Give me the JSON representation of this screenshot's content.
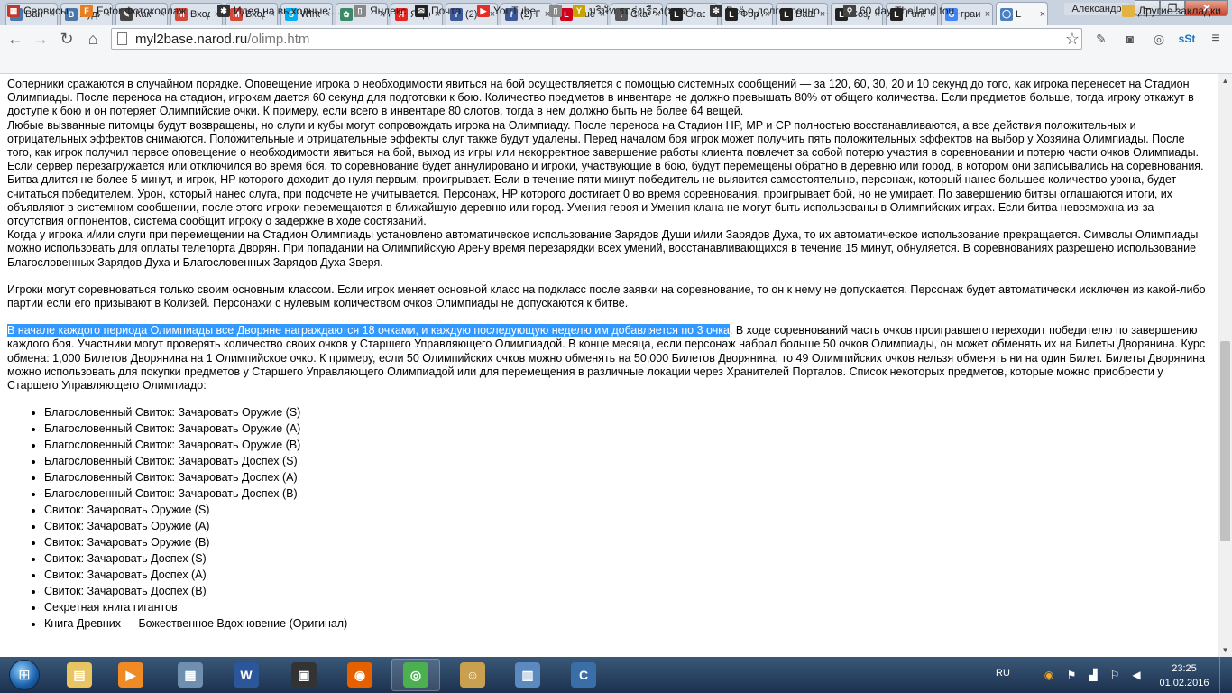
{
  "tabs": [
    {
      "label": "Ван",
      "icon": "vk-icon",
      "color": "#4a76a8",
      "glyph": "В"
    },
    {
      "label": "Ауди",
      "icon": "vk-icon",
      "color": "#4a76a8",
      "glyph": "В"
    },
    {
      "label": "Как",
      "icon": "pin-icon",
      "color": "#444444",
      "glyph": "✎"
    },
    {
      "label": "Вход",
      "icon": "gmail-icon",
      "color": "#d44638",
      "glyph": "M"
    },
    {
      "label": "Вход",
      "icon": "gmail-icon",
      "color": "#d44638",
      "glyph": "M"
    },
    {
      "label": "Winc",
      "icon": "skype-icon",
      "color": "#00aff0",
      "glyph": "S"
    },
    {
      "label": "Ol",
      "icon": "gear-icon",
      "color": "#3a8a6a",
      "glyph": "✿"
    },
    {
      "label": "Янде",
      "icon": "yandex-icon",
      "color": "#e52620",
      "glyph": "Я"
    },
    {
      "label": "(2) F",
      "icon": "facebook-icon",
      "color": "#3b5998",
      "glyph": "f"
    },
    {
      "label": "(2) F",
      "icon": "facebook-icon",
      "color": "#3b5998",
      "glyph": "f"
    },
    {
      "label": "Blue",
      "icon": "blue-icon",
      "color": "#d0021b",
      "glyph": "L"
    },
    {
      "label": "Скач",
      "icon": "download-icon",
      "color": "#555555",
      "glyph": "↓"
    },
    {
      "label": "Grac",
      "icon": "lineage-icon",
      "color": "#222222",
      "glyph": "L"
    },
    {
      "label": "Фор",
      "icon": "lineage-icon",
      "color": "#222222",
      "glyph": "L"
    },
    {
      "label": "Ваш",
      "icon": "lineage-icon",
      "color": "#222222",
      "glyph": "L"
    },
    {
      "label": "Созд",
      "icon": "lineage-icon",
      "color": "#222222",
      "glyph": "L"
    },
    {
      "label": "Fun6",
      "icon": "lineage-icon",
      "color": "#222222",
      "glyph": "L"
    },
    {
      "label": "граи",
      "icon": "google-icon",
      "color": "#4285f4",
      "glyph": "G"
    },
    {
      "label": "L",
      "icon": "olimp-icon",
      "color": "#4a7fc0",
      "glyph": "◯",
      "active": true
    }
  ],
  "user_name": "Александр",
  "address": {
    "host": "myl2base.narod.ru",
    "path": "/olimp.htm"
  },
  "bookmarks": [
    {
      "label": "Сервисы",
      "icon": "apps-grid-icon",
      "color": "#c0392b",
      "glyph": "▦"
    },
    {
      "label": "Fotor Фотоколлаж ...",
      "icon": "fotor-icon",
      "color": "#e67e22",
      "glyph": "F"
    },
    {
      "label": "Идея на выходные:...",
      "icon": "idea-icon",
      "color": "#333333",
      "glyph": "✱"
    },
    {
      "label": "Яндекс",
      "icon": "page-icon",
      "color": "#888888",
      "glyph": "▯"
    },
    {
      "label": "Почта",
      "icon": "mail-icon",
      "color": "#222222",
      "glyph": "✉"
    },
    {
      "label": "YouTube",
      "icon": "youtube-icon",
      "color": "#e52d27",
      "glyph": "▶"
    },
    {
      "label": "",
      "icon": "page-icon",
      "color": "#888888",
      "glyph": "▯"
    },
    {
      "label": "บริษัท รถรุ่งเรือง(มุกดา...",
      "icon": "thai-company-icon",
      "color": "#c9a400",
      "glyph": "Y"
    },
    {
      "label": "Всё о долгосрочно...",
      "icon": "palm-icon",
      "color": "#333333",
      "glyph": "✼"
    },
    {
      "label": "60 day Thailand tou...",
      "icon": "bike-icon",
      "color": "#444444",
      "glyph": "⚲"
    }
  ],
  "other_bookmarks": "Другие закладки",
  "article": {
    "p1": "Соперники сражаются в случайном порядке. Оповещение игрока о необходимости явиться на бой осуществляется с помощью системных сообщений — за 120, 60, 30, 20 и 10 секунд до того, как игрока перенесет на Стадион Олимпиады. После переноса на стадион, игрокам дается 60 секунд для подготовки к бою. Количество предметов в инвентаре не должно превышать 80% от общего количества. Если предметов больше, тогда игроку откажут в доступе к бою и он потеряет Олимпийские очки. К примеру, если всего в инвентаре 80 слотов, тогда в нем должно быть не более 64 вещей.",
    "p2": "Любые вызванные питомцы будут возвращены, но слуги и кубы могут сопровождать игрока на Олимпиаду. После переноса на Стадион HP, MP и CP полностью восстанавливаются, а все действия положительных и отрицательных эффектов снимаются. Положительные и отрицательные эффекты слуг также будут удалены. Перед началом боя игрок может получить пять положительных эффектов на выбор у Хозяина Олимпиады. После того, как игрок получил первое оповещение о необходимости явиться на бой, выход из игры или некорректное завершение работы клиента повлечет за собой потерю участия в соревновании и потерю части очков Олимпиады. Если сервер перезагружается или отключился во время боя, то соревнование будет аннулировано и игроки, участвующие в бою, будут перемещены обратно в деревню или город, в котором они записывались на соревнования.",
    "p3": "Битва длится не более 5 минут, и игрок, HP которого доходит до нуля первым, проигрывает. Если в течение пяти минут победитель не выявится самостоятельно, персонаж, который нанес большее количество урона, будет считаться победителем. Урон, который нанес слуга, при подсчете не учитывается. Персонаж, HP которого достигает 0 во время соревнования, проигрывает бой, но не умирает. По завершению битвы оглашаются итоги, их объявляют в системном сообщении, после этого игроки перемещаются в ближайшую деревню или город. Умения героя и Умения клана не могут быть использованы в Олимпийских играх. Если битва невозможна из-за отсутствия оппонентов, система сообщит игроку о задержке в ходе состязаний.",
    "p4": "Когда у игрока и/или слуги при перемещении на Стадион Олимпиады установлено автоматическое использование Зарядов Души и/или Зарядов Духа, то их автоматическое использование прекращается. Символы Олимпиады можно использовать для оплаты телепорта Дворян. При попадании на Олимпийскую Арену время перезарядки всех умений, восстанавливающихся в течение 15 минут, обнуляется. В соревнованиях разрешено использование Благословенных Зарядов Духа и Благословенных Зарядов Духа Зверя.",
    "p5": "Игроки могут соревноваться только своим основным классом. Если игрок меняет основной класс на подкласс после заявки на соревнование, то он к нему не допускается. Персонаж будет автоматически исключен из какой-либо партии если его призывают в Колизей. Персонажи с нулевым количеством очков Олимпиады не допускаются к битве.",
    "p6_highlight": "В начале каждого периода Олимпиады все Дворяне награждаются 18 очками, и каждую последующую неделю им добавляется по 3 очка",
    "p6_rest": ". В ходе соревнований часть очков проигравшего переходит победителю по завершению каждого боя. Участники могут проверять количество своих очков у Старшего Управляющего Олимпиадой. В конце месяца, если персонаж набрал больше 50 очков Олимпиады, он может обменять их на Билеты Дворянина. Курс обмена: 1,000 Билетов Дворянина на 1 Олимпийское очко. К примеру, если 50 Олимпийских очков можно обменять на 50,000 Билетов Дворянина, то 49 Олимпийских очков нельзя обменять ни на один Билет. Билеты Дворянина можно использовать для покупки предметов у Старшего Управляющего Олимпиадой или для перемещения в различные локации через Хранителей Порталов. Список некоторых предметов, которые можно приобрести у Старшего Управляющего Олимпиадо:"
  },
  "items": [
    "Благословенный Свиток: Зачаровать Оружие (S)",
    "Благословенный Свиток: Зачаровать Оружие (A)",
    "Благословенный Свиток: Зачаровать Оружие (B)",
    "Благословенный Свиток: Зачаровать Доспех (S)",
    "Благословенный Свиток: Зачаровать Доспех (A)",
    "Благословенный Свиток: Зачаровать Доспех (B)",
    "Свиток: Зачаровать Оружие (S)",
    "Свиток: Зачаровать Оружие (A)",
    "Свиток: Зачаровать Оружие (B)",
    "Свиток: Зачаровать Доспех (S)",
    "Свиток: Зачаровать Доспех (A)",
    "Свиток: Зачаровать Доспех (B)",
    "Секретная книга гигантов",
    "Книга Древних — Божественное Вдохновение (Оригинал)"
  ],
  "taskbar": [
    {
      "icon": "explorer-folder-icon",
      "color": "#e8c560",
      "glyph": "▤"
    },
    {
      "icon": "media-player-icon",
      "color": "#f08a24",
      "glyph": "▶"
    },
    {
      "icon": "calculator-icon",
      "color": "#6f8fb0",
      "glyph": "▦"
    },
    {
      "icon": "word-icon",
      "color": "#2b579a",
      "glyph": "W"
    },
    {
      "icon": "video-editor-icon",
      "color": "#333333",
      "glyph": "▣"
    },
    {
      "icon": "firefox-icon",
      "color": "#e66000",
      "glyph": "◉"
    },
    {
      "icon": "chrome-icon",
      "color": "#4caf50",
      "glyph": "◎"
    },
    {
      "icon": "game-character-icon",
      "color": "#c8a050",
      "glyph": "☺"
    },
    {
      "icon": "control-panel-icon",
      "color": "#5a8ac0",
      "glyph": "▥"
    },
    {
      "icon": "app-c-icon",
      "color": "#3a6ea8",
      "glyph": "C"
    }
  ],
  "tray": {
    "lang": "RU",
    "time": "23:25",
    "date": "01.02.2016"
  }
}
